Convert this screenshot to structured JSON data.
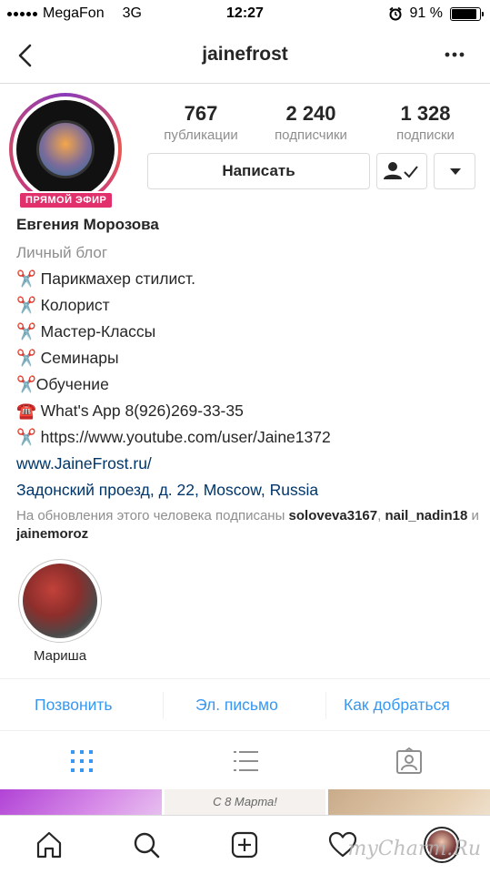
{
  "status_bar": {
    "carrier": "MegaFon",
    "network": "3G",
    "time": "12:27",
    "battery_text": "91 %",
    "battery_level": 0.91
  },
  "header": {
    "title": "jainefrost"
  },
  "profile": {
    "live_badge": "ПРЯМОЙ ЭФИР",
    "stats": [
      {
        "value": "767",
        "label": "публикации"
      },
      {
        "value": "2 240",
        "label": "подписчики"
      },
      {
        "value": "1 328",
        "label": "подписки"
      }
    ],
    "message_button": "Написать"
  },
  "bio": {
    "name": "Евгения Морозова",
    "category": "Личный блог",
    "lines": [
      "✂️ Парикмахер стилист.",
      "✂️ Колорист",
      "✂️ Мастер-Классы",
      "✂️ Семинары",
      "✂️Обучение",
      "☎️ What's App 8(926)269-33-35",
      "✂️ https://www.youtube.com/user/Jaine1372"
    ],
    "website": "www.JaineFrost.ru/",
    "address": "Задонский проезд, д. 22, Moscow, Russia",
    "followed_prefix": "На обновления этого человека подписаны ",
    "followed_user1": "soloveva3167",
    "followed_sep1": ",",
    "followed_user2": "nail_nadin18",
    "followed_and": " и ",
    "followed_user3": "jainemoroz"
  },
  "highlight": {
    "label": "Мариша"
  },
  "contact": {
    "call": "Позвонить",
    "email": "Эл. письмо",
    "directions": "Как добраться"
  },
  "grid_preview": {
    "post2_caption": "С 8 Марта!"
  },
  "watermark": "myCharm.Ru",
  "colors": {
    "link_blue": "#3897f0",
    "dark_link": "#003569",
    "live_pink": "#e1306c"
  }
}
